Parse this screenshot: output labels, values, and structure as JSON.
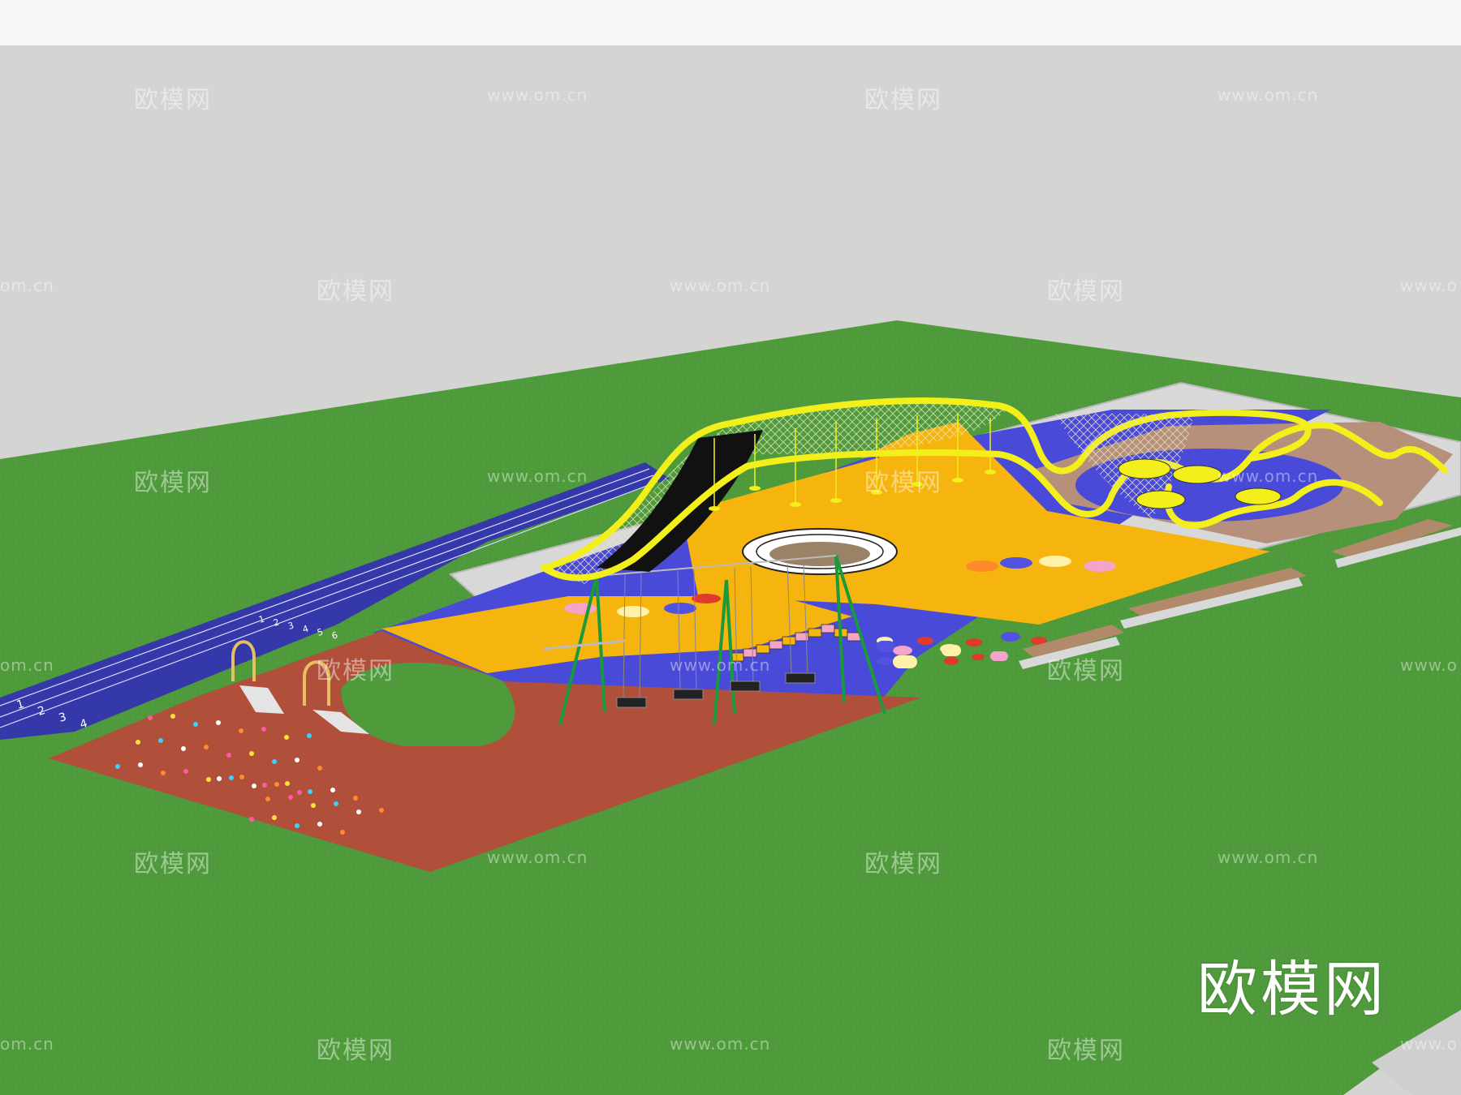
{
  "scene": {
    "sky_color": "#d4d4d2",
    "top_bar_color": "#f6f6f6",
    "grass_color": "#4f9a3a",
    "grass_dark": "#3f8430",
    "blue_surface": "#4a4ad8",
    "yellow_surface": "#f6b40e",
    "red_surface": "#b0503a",
    "track_color": "#3438a8",
    "tube_color": "#f2ef1a",
    "slide_color": "#111111",
    "wood_color": "#b08a6a"
  },
  "track": {
    "lane_numbers_near": [
      "1",
      "2",
      "3",
      "4"
    ],
    "lane_numbers_far": [
      "1",
      "2",
      "3",
      "4",
      "5",
      "6"
    ]
  },
  "watermarks": {
    "logo": "欧模网",
    "url": "www.om.cn",
    "url_partial": "om.cn",
    "url_cut": "www.o"
  },
  "brand": {
    "text": "欧模网"
  }
}
